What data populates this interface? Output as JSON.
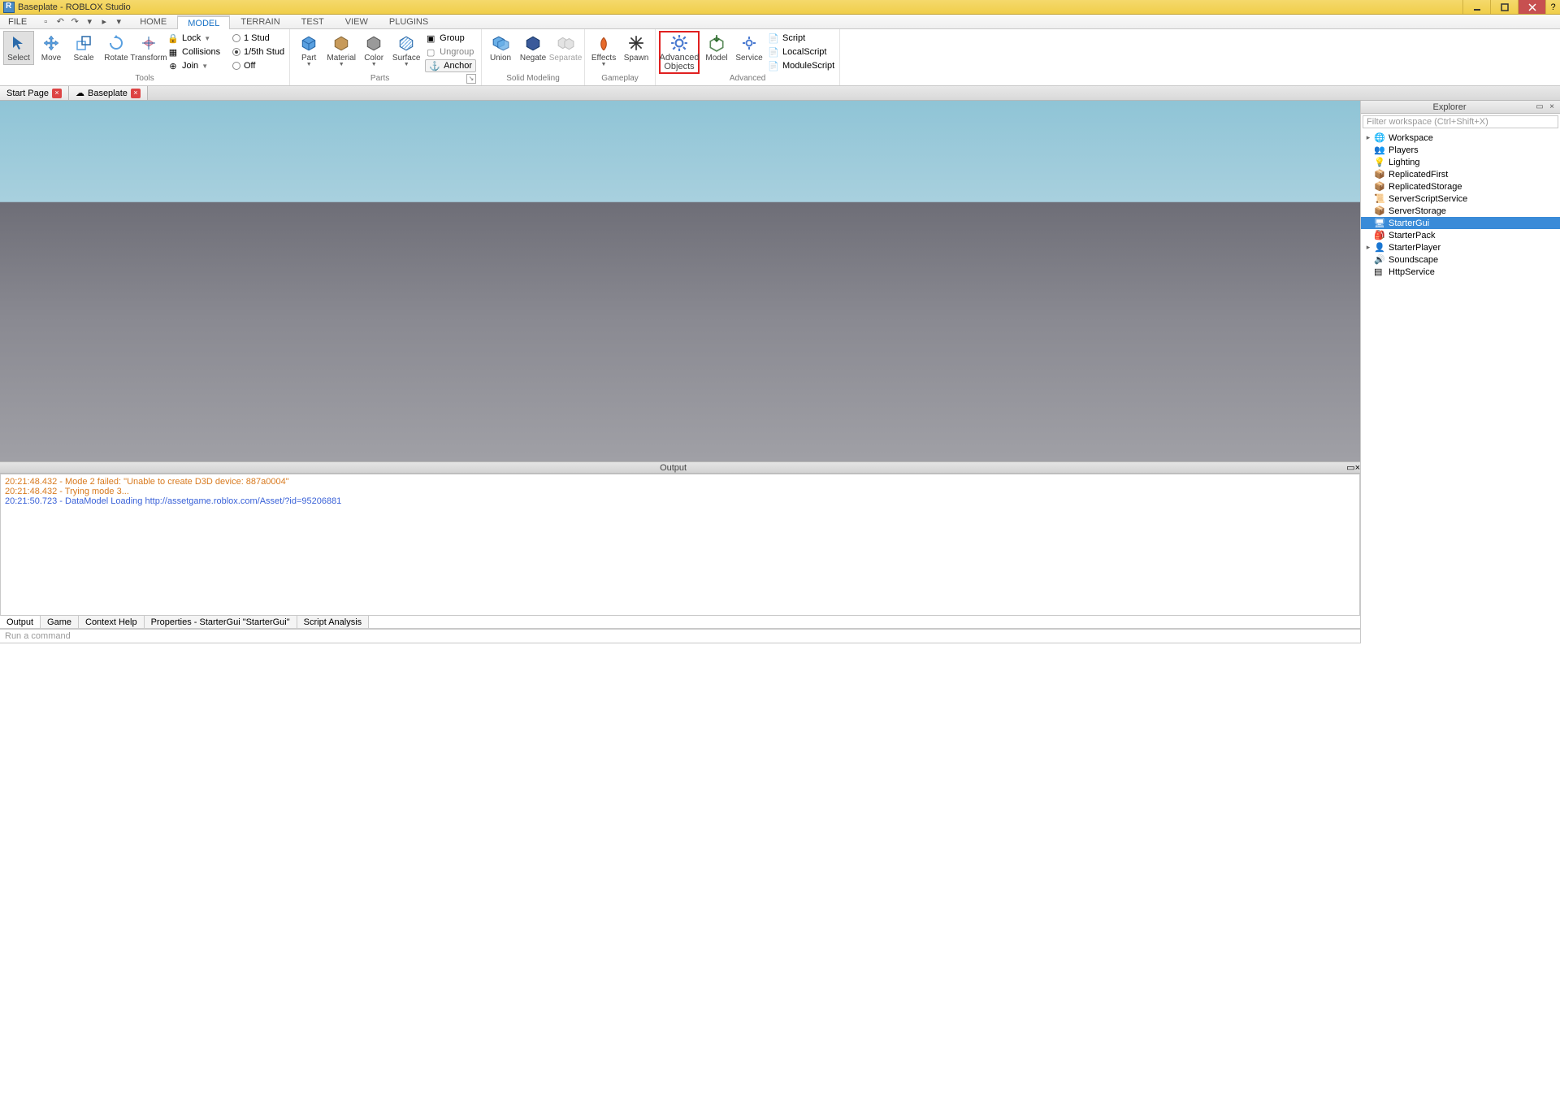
{
  "window": {
    "title": "Baseplate - ROBLOX Studio"
  },
  "menu": {
    "file": "FILE"
  },
  "tabs": {
    "home": "HOME",
    "model": "MODEL",
    "terrain": "TERRAIN",
    "test": "TEST",
    "view": "VIEW",
    "plugins": "PLUGINS"
  },
  "ribbon": {
    "tools": {
      "select": "Select",
      "move": "Move",
      "scale": "Scale",
      "rotate": "Rotate",
      "transform": "Transform",
      "lock": "Lock",
      "collisions": "Collisions",
      "join": "Join",
      "stud1": "1 Stud",
      "stud15": "1/5th Stud",
      "off": "Off",
      "group_title": "Tools"
    },
    "parts": {
      "part": "Part",
      "material": "Material",
      "color": "Color",
      "surface": "Surface",
      "group": "Group",
      "ungroup": "Ungroup",
      "anchor": "Anchor",
      "group_title": "Parts"
    },
    "solid": {
      "union": "Union",
      "negate": "Negate",
      "separate": "Separate",
      "group_title": "Solid Modeling"
    },
    "gameplay": {
      "effects": "Effects",
      "spawn": "Spawn",
      "group_title": "Gameplay"
    },
    "advanced": {
      "advobj_l1": "Advanced",
      "advobj_l2": "Objects",
      "model": "Model",
      "service": "Service",
      "script": "Script",
      "localscript": "LocalScript",
      "modulescript": "ModuleScript",
      "group_title": "Advanced"
    }
  },
  "doctabs": {
    "start": "Start Page",
    "baseplate": "Baseplate"
  },
  "explorer": {
    "title": "Explorer",
    "filter_placeholder": "Filter workspace (Ctrl+Shift+X)",
    "nodes": {
      "workspace": "Workspace",
      "players": "Players",
      "lighting": "Lighting",
      "repfirst": "ReplicatedFirst",
      "repstorage": "ReplicatedStorage",
      "sss": "ServerScriptService",
      "sstorage": "ServerStorage",
      "startergui": "StarterGui",
      "starterpack": "StarterPack",
      "starterplayer": "StarterPlayer",
      "soundscape": "Soundscape",
      "httpservice": "HttpService"
    }
  },
  "output": {
    "title": "Output",
    "line1": "20:21:48.432 - Mode 2 failed: \"Unable to create D3D device: 887a0004\"",
    "line2": "20:21:48.432 - Trying mode 3...",
    "line3": "20:21:50.723 - DataModel Loading http://assetgame.roblox.com/Asset/?id=95206881"
  },
  "btabs": {
    "output": "Output",
    "game": "Game",
    "context": "Context Help",
    "props": "Properties - StarterGui \"StarterGui\"",
    "script": "Script Analysis"
  },
  "cmd": {
    "placeholder": "Run a command"
  }
}
